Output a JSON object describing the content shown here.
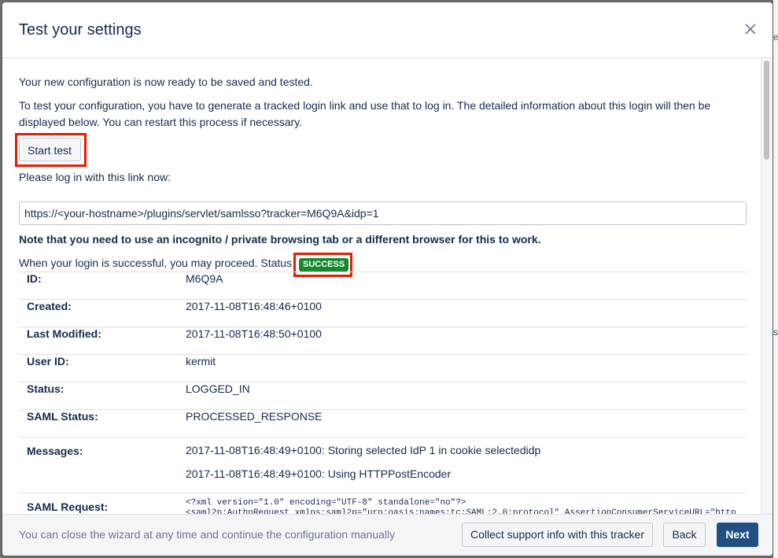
{
  "dialog": {
    "title": "Test your settings",
    "intro": "Your new configuration is now ready to be saved and tested.",
    "instructions_line1": "To test your configuration, you have to generate a tracked login link and use that to log in. The detailed information about this login will then be",
    "instructions_line2": "displayed below. You can restart this process if necessary.",
    "start_test_label": "Start test",
    "login_prompt": "Please log in with this link now:",
    "login_link": "https://<your-hostname>/plugins/servlet/samlsso?tracker=M6Q9A&idp=1",
    "incognito_note": "Note that you need to use an incognito / private browsing tab or a different browser for this to work.",
    "status_prefix": "When your login is successful, you may proceed. Status",
    "status_badge": "SUCCESS",
    "details": {
      "id_label": "ID:",
      "id_value": "M6Q9A",
      "created_label": "Created:",
      "created_value": "2017-11-08T16:48:46+0100",
      "modified_label": "Last Modified:",
      "modified_value": "2017-11-08T16:48:50+0100",
      "user_label": "User ID:",
      "user_value": "kermit",
      "status_label": "Status:",
      "status_value": "LOGGED_IN",
      "saml_status_label": "SAML Status:",
      "saml_status_value": "PROCESSED_RESPONSE",
      "messages_label": "Messages:",
      "message_1": "2017-11-08T16:48:49+0100: Storing selected IdP 1 in cookie selectedidp",
      "message_2": "2017-11-08T16:48:49+0100: Using HTTPPostEncoder",
      "saml_request_label": "SAML Request:",
      "saml_request_line1": "<?xml version=\"1.0\" encoding=\"UTF-8\" standalone=\"no\"?>",
      "saml_request_line2": "<saml2p:AuthnRequest xmlns:saml2p=\"urn:oasis:names:tc:SAML:2.0:protocol\" AssertionConsumerServiceURL=\"http"
    },
    "footer_hint": "You can close the wizard at any time and continue the configuration manually",
    "collect_label": "Collect support info with this tracker",
    "back_label": "Back",
    "next_label": "Next"
  },
  "colors": {
    "success": "#14892c",
    "primary": "#205081",
    "highlight": "#e51c00"
  },
  "icons": {
    "close": "close-icon"
  }
}
